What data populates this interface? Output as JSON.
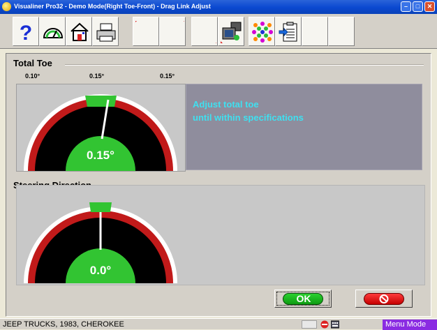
{
  "window": {
    "title": "Visualiner Pro32 - Demo Mode(Right Toe-Front)  - Drag Link Adjust"
  },
  "toolbar": {
    "buttons": [
      {
        "name": "help-icon"
      },
      {
        "name": "gauge-icon"
      },
      {
        "name": "home-icon"
      },
      {
        "name": "printer-icon"
      },
      {
        "name": "blank-corner-icon"
      },
      {
        "name": "blank-corner-icon"
      },
      {
        "name": "blank-icon"
      },
      {
        "name": "vehicle-camera-icon"
      },
      {
        "name": "target-dots-icon"
      },
      {
        "name": "clipboard-arrow-icon"
      },
      {
        "name": "blank-icon"
      },
      {
        "name": "blank-icon"
      }
    ]
  },
  "total_toe": {
    "title": "Total Toe",
    "spec_min": "0.10°",
    "spec_target": "0.15°",
    "spec_max": "0.15°",
    "reading": "0.15°",
    "reading_value": 0.15
  },
  "message": {
    "line1": "Adjust total toe",
    "line2": "until within specifications"
  },
  "steering": {
    "title": "Steering Direction",
    "reading": "0.0°",
    "reading_value": 0.0
  },
  "buttons": {
    "ok_label": "OK",
    "cancel_icon": "cancel-icon"
  },
  "status": {
    "vehicle": "JEEP TRUCKS, 1983, CHEROKEE",
    "mode": "Menu Mode"
  },
  "colors": {
    "gauge_red": "#c11a1a",
    "gauge_green": "#32c432",
    "gauge_black": "#000000",
    "message_text": "#3fe0f0",
    "mode_bg": "#8a2be2"
  }
}
